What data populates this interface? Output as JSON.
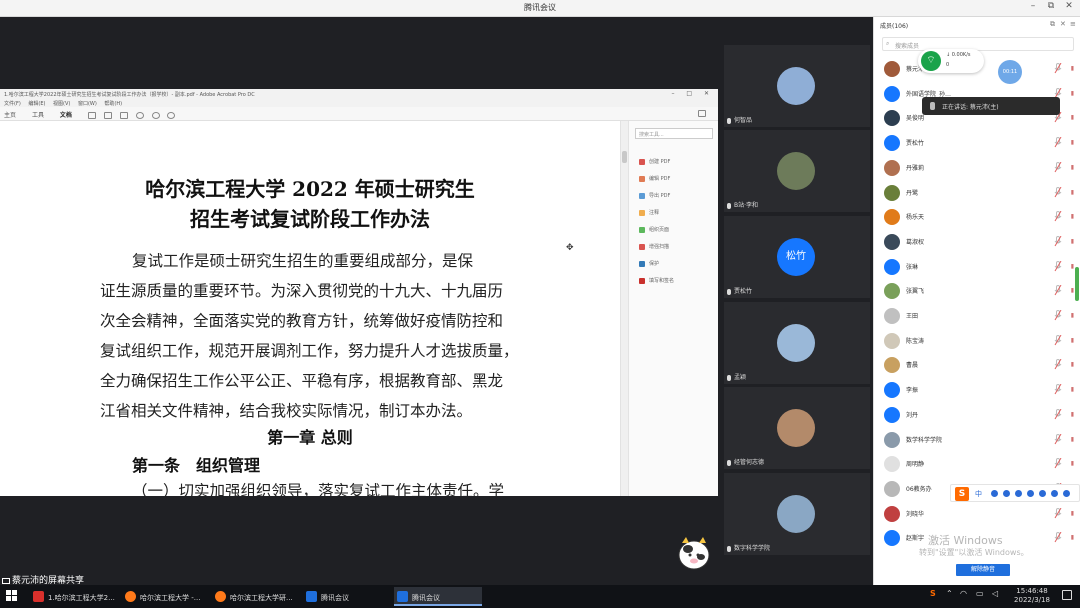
{
  "window": {
    "title": "腾讯会议",
    "controls": [
      "–",
      "⧉",
      "✕"
    ]
  },
  "pdf": {
    "title_bar": "1.哈尔滨工程大学2022年硕士研究生招生考试复试阶段工作办法（报学校）- 副本.pdf - Adobe Acrobat Pro DC",
    "window_controls": "– □ ✕",
    "menu": [
      "文件(F)",
      "编辑(E)",
      "视图(V)",
      "窗口(W)",
      "帮助(H)"
    ],
    "tabs": [
      "主页",
      "工具",
      "文档"
    ],
    "title_line1": "哈尔滨工程大学 2022 年硕士研究生",
    "title_line2": "招生考试复试阶段工作办法",
    "para_lines": [
      "复试工作是硕士研究生招生的重要组成部分，是保",
      "证生源质量的重要环节。为深入贯彻党的十九大、十九届历",
      "次全会精神，全面落实党的教育方针，统筹做好疫情防控和",
      "复试组织工作，规范开展调剂工作，努力提升人才选拔质量，",
      "全力确保招生工作公平公正、平稳有序，根据教育部、黑龙",
      "江省相关文件精神，结合我校实际情况，制订本办法。"
    ],
    "chapter": "第一章 总则",
    "article": "第一条　组织管理",
    "item1": "（一）切实加强组织领导，落实复试工作主体责任。学",
    "side_search": "搜索工具...",
    "side_items": [
      {
        "label": "创建 PDF",
        "color": "#d9534f"
      },
      {
        "label": "编辑 PDF",
        "color": "#e07b54"
      },
      {
        "label": "导出 PDF",
        "color": "#5b9bd5"
      },
      {
        "label": "注释",
        "color": "#f0ad4e"
      },
      {
        "label": "组织页面",
        "color": "#5cb85c"
      },
      {
        "label": "增强扫描",
        "color": "#d9534f"
      },
      {
        "label": "保护",
        "color": "#337ab7"
      },
      {
        "label": "填写和签名",
        "color": "#c9302c"
      }
    ]
  },
  "video_tiles": [
    {
      "name": "何智品",
      "color": "#8faed6"
    },
    {
      "name": "B站·李和",
      "color": "#6d7b5a"
    },
    {
      "name": "贾松竹",
      "avatar_text": "松竹",
      "color": "#1677ff"
    },
    {
      "name": "孟颖",
      "color": "#9ab8d8"
    },
    {
      "name": "经管何志德",
      "color": "#b38a6a"
    },
    {
      "name": "数字科学学院",
      "color": "#8aa7c4"
    }
  ],
  "panel": {
    "title": "成员(106)",
    "search_placeholder": "搜索成员",
    "members": [
      {
        "name": "蔡元沛",
        "color": "#a05a3a"
      },
      {
        "name": "外国语学院_孙…",
        "color": "#1677ff"
      },
      {
        "name": "吴俊明",
        "color": "#2c3e50"
      },
      {
        "name": "贾松竹",
        "color": "#1677ff"
      },
      {
        "name": "丹雅莉",
        "color": "#b07050"
      },
      {
        "name": "丹鹭",
        "color": "#6a7f3a"
      },
      {
        "name": "杨乐天",
        "color": "#e07b1a"
      },
      {
        "name": "葛淑权",
        "color": "#3a4a5a"
      },
      {
        "name": "张琳",
        "color": "#1677ff"
      },
      {
        "name": "张翼飞",
        "color": "#7aa05a"
      },
      {
        "name": "王田",
        "color": "#c0c0c0"
      },
      {
        "name": "陈宝涛",
        "color": "#d0c8b8"
      },
      {
        "name": "曹晨",
        "color": "#c8a060"
      },
      {
        "name": "李振",
        "color": "#1677ff"
      },
      {
        "name": "刘丹",
        "color": "#1677ff"
      },
      {
        "name": "数学科学学院",
        "color": "#8a9aaa"
      },
      {
        "name": "周明静",
        "color": "#e0e0e0"
      },
      {
        "name": "06教务办",
        "color": "#b8b8b8"
      },
      {
        "name": "刘晓华",
        "color": "#c04040"
      },
      {
        "name": "赵斯宇",
        "color": "#1677ff"
      }
    ],
    "bottom_button": "解除静音"
  },
  "overlays": {
    "speaking": "正在讲话: 蔡元沛(主)",
    "net_speed": "↓ 0.00K/s",
    "net_count": "0",
    "blue_pill": "00:11",
    "ime_lang": "中",
    "watermark_line1": "激活 Windows",
    "watermark_line2": "转到\"设置\"以激活 Windows。",
    "share_label": "蔡元沛的屏幕共享"
  },
  "taskbar": {
    "tasks": [
      {
        "label": "1.哈尔滨工程大学2...",
        "color": "#d9302c"
      },
      {
        "label": "哈尔滨工程大学 -...",
        "color": "#ff7a1a"
      },
      {
        "label": "哈尔滨工程大学研...",
        "color": "#ff7a1a"
      },
      {
        "label": "腾讯会议",
        "color": "#1f6fdd"
      },
      {
        "label": "腾讯会议",
        "color": "#1f6fdd"
      }
    ],
    "time": "15:46:48",
    "date": "2022/3/18"
  }
}
